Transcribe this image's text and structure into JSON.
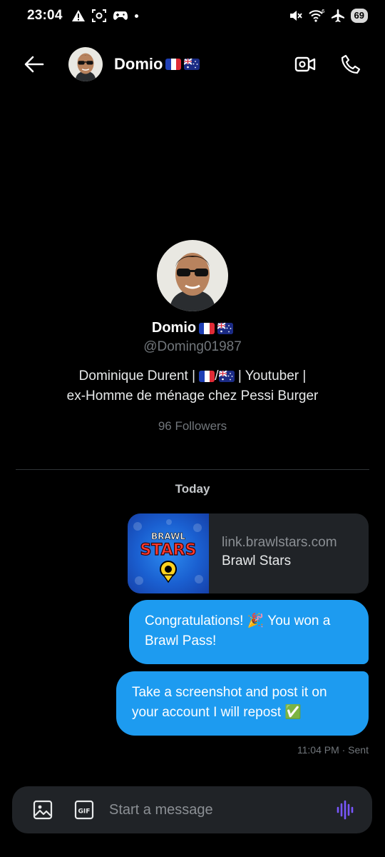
{
  "status_bar": {
    "time": "23:04",
    "battery": "69",
    "icons": [
      "alert-icon",
      "screenshot-icon",
      "game-controller-icon",
      "notification-dot",
      "mute-icon",
      "wifi-6-icon",
      "airplane-icon",
      "battery-icon"
    ]
  },
  "header": {
    "name": "Domio",
    "flags": [
      "france-flag",
      "australia-flag"
    ],
    "icons": [
      "back-arrow-icon",
      "video-call-icon",
      "phone-call-icon"
    ]
  },
  "profile": {
    "name": "Domio",
    "handle": "@Doming01987",
    "bio_part1": "Dominique Durent | ",
    "bio_part2": " | Youtuber |",
    "bio_line2": "ex-Homme de ménage chez Pessi Burger",
    "followers": "96 Followers"
  },
  "conversation": {
    "date_label": "Today",
    "link_card": {
      "logo_line1": "BRAWL",
      "logo_line2": "STARS",
      "domain": "link.brawlstars.com",
      "title": "Brawl Stars"
    },
    "messages": [
      {
        "before": "Congratulations! ",
        "emoji": "🎉",
        "after": " You won a Brawl Pass!"
      },
      {
        "before": "Take a screenshot and post it on your account I will repost ",
        "emoji": "✅",
        "after": ""
      }
    ],
    "meta": "11:04 PM · Sent"
  },
  "composer": {
    "placeholder": "Start a message",
    "gif_label": "GIF",
    "icons": [
      "image-icon",
      "gif-icon",
      "voice-message-icon"
    ]
  },
  "colors": {
    "background": "#000000",
    "bubble": "#1d9bf0",
    "card": "#202327",
    "muted_text": "#71767b",
    "voice_icon": "#7856ff"
  }
}
